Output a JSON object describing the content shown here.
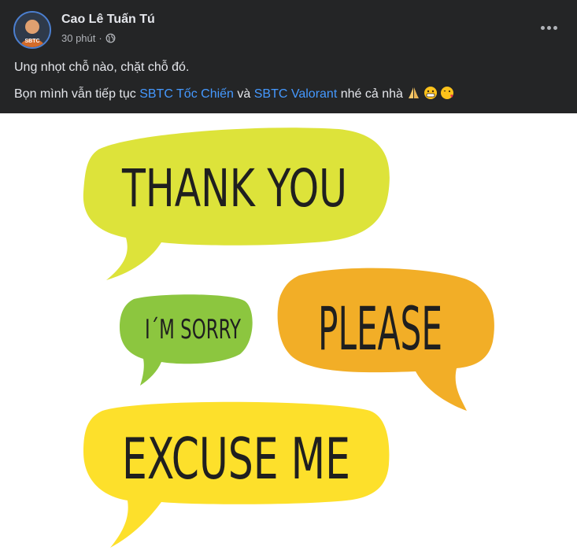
{
  "post": {
    "author_name": "Cao Lê Tuấn Tú",
    "time": "30 phút",
    "separator": "·",
    "privacy_icon": "globe-icon",
    "more_icon": "more-options-icon",
    "avatar_badge": "SBTC"
  },
  "caption": {
    "line1": "Ung nhọt chỗ nào, chặt chỗ đó.",
    "line2_prefix": "Bọn mình vẫn tiếp tục ",
    "link1": "SBTC Tốc Chiến",
    "line2_mid": " và ",
    "link2": "SBTC Valorant",
    "line2_suffix": " nhé cả nhà ",
    "emojis": [
      "folded-hands",
      "grimacing-face",
      "face-blowing-kiss"
    ]
  },
  "image": {
    "bubbles": [
      {
        "text": "THANK YOU",
        "color": "#dde33a"
      },
      {
        "text": "I´M SORRY",
        "color": "#8cc63f"
      },
      {
        "text": "PLEASE",
        "color": "#f2ae27"
      },
      {
        "text": "EXCUSE ME",
        "color": "#fde02b"
      }
    ]
  }
}
